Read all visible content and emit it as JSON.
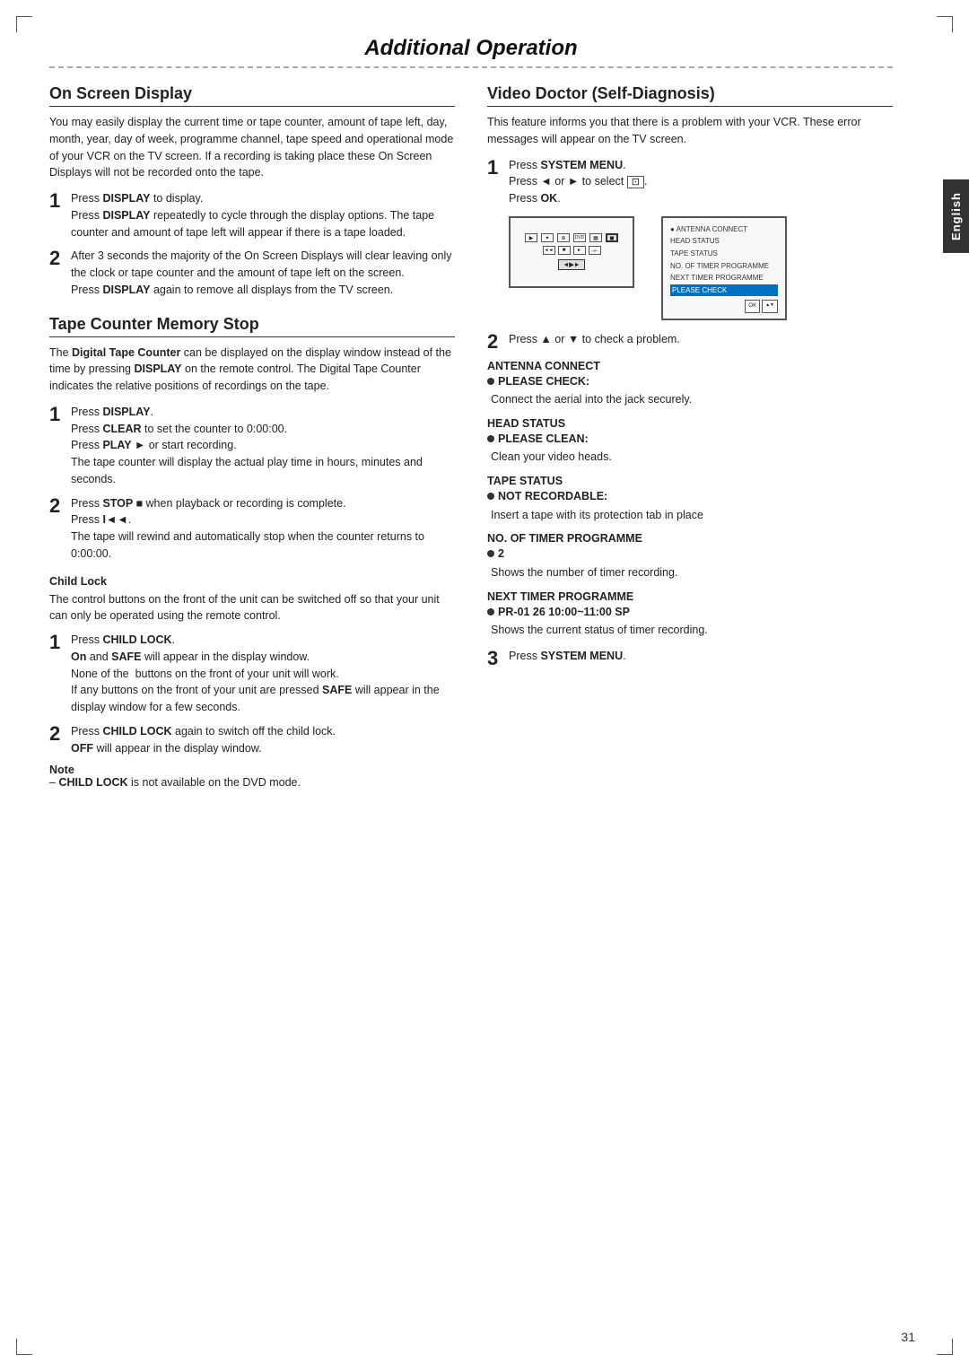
{
  "page": {
    "title": "Additional Operation",
    "page_number": "31",
    "english_tab": "English"
  },
  "left_col": {
    "on_screen_display": {
      "title": "On Screen Display",
      "intro": "You may easily display the current time or tape counter, amount of tape left, day, month, year, day of week, programme channel, tape speed and operational mode of your VCR on the TV screen. If a recording is taking place these On Screen Displays will not be recorded onto the tape.",
      "steps": [
        {
          "number": "1",
          "lines": [
            "Press DISPLAY to display.",
            "Press DISPLAY repeatedly to cycle through the display options. The tape counter and amount of tape left will appear if there is a tape loaded."
          ]
        },
        {
          "number": "2",
          "lines": [
            "After 3 seconds the majority of the On Screen Displays will clear leaving only the clock or tape counter and the amount of tape left on the screen.",
            "Press DISPLAY again to remove all displays from the TV screen."
          ]
        }
      ]
    },
    "tape_counter": {
      "title": "Tape Counter Memory Stop",
      "intro": "The Digital Tape Counter can be displayed on the display window instead of the time by pressing DISPLAY on the remote control. The Digital Tape Counter indicates the relative positions of recordings on the tape.",
      "steps": [
        {
          "number": "1",
          "lines": [
            "Press DISPLAY.",
            "Press CLEAR to set the counter to 0:00:00.",
            "Press PLAY ► or start recording.",
            "The tape counter will display the actual play time in hours, minutes and seconds."
          ]
        },
        {
          "number": "2",
          "lines": [
            "Press STOP ■ when playback or recording is complete.",
            "Press I◄◄.",
            "The tape will rewind and automatically stop when the counter returns to 0:00:00."
          ]
        }
      ]
    },
    "child_lock": {
      "title": "Child Lock",
      "intro": "The control buttons on the front of the unit can be switched off so that your unit can only be operated using the remote control.",
      "steps": [
        {
          "number": "1",
          "lines": [
            "Press CHILD LOCK.",
            "On and SAFE will appear in the display window.",
            "None of the  buttons on the front of your unit will work.",
            "If any buttons on the front of your unit are pressed SAFE will appear in the display window for a few seconds."
          ]
        },
        {
          "number": "2",
          "lines": [
            "Press CHILD LOCK again to switch off the child lock.",
            "OFF will appear in the display window."
          ]
        }
      ],
      "note": {
        "label": "Note",
        "text": "– CHILD LOCK is not available on the DVD mode."
      }
    }
  },
  "right_col": {
    "video_doctor": {
      "title": "Video Doctor (Self-Diagnosis)",
      "intro": "This feature informs you that there is a problem with your VCR. These error messages will appear on the TV screen.",
      "step1": {
        "number": "1",
        "lines": [
          "Press SYSTEM MENU.",
          "Press ◄ or ► to select   .",
          "Press OK."
        ]
      },
      "tv_top_icons": [
        "▶",
        "✦",
        "⊕",
        "DVD",
        "▦"
      ],
      "tv_top_bottom_icons": [
        "◄◄",
        "■",
        "►►"
      ],
      "tv_selected_label": "◄▶►",
      "tv_menu_items": [
        "● ANTENNA CONNECT",
        "HEAD STATUS",
        "TAPE STATUS",
        "NO. OF TIMER PROGRAMME",
        "NEXT TIMER PROGRAMME",
        "PLEASE CHECK"
      ],
      "step2": {
        "number": "2",
        "label": "Press ▲ or ▼ to check a problem."
      },
      "antenna_connect": {
        "title": "ANTENNA CONNECT",
        "bullet": "PLEASE CHECK:",
        "text": "Connect the aerial into the jack securely."
      },
      "head_status": {
        "title": "HEAD STATUS",
        "bullet": "PLEASE CLEAN:",
        "text": "Clean your video heads."
      },
      "tape_status": {
        "title": "TAPE STATUS",
        "bullet": "NOT RECORDABLE:",
        "text": "Insert a tape with its protection tab in place"
      },
      "no_of_timer": {
        "title": "NO. OF TIMER PROGRAMME",
        "bullet": "2",
        "text": "Shows the number of timer recording."
      },
      "next_timer": {
        "title": "NEXT TIMER PROGRAMME",
        "bullet": "PR-01 26 10:00~11:00 SP",
        "text": "Shows the current status of timer recording."
      },
      "step3": {
        "number": "3",
        "text": "Press SYSTEM MENU."
      }
    }
  }
}
